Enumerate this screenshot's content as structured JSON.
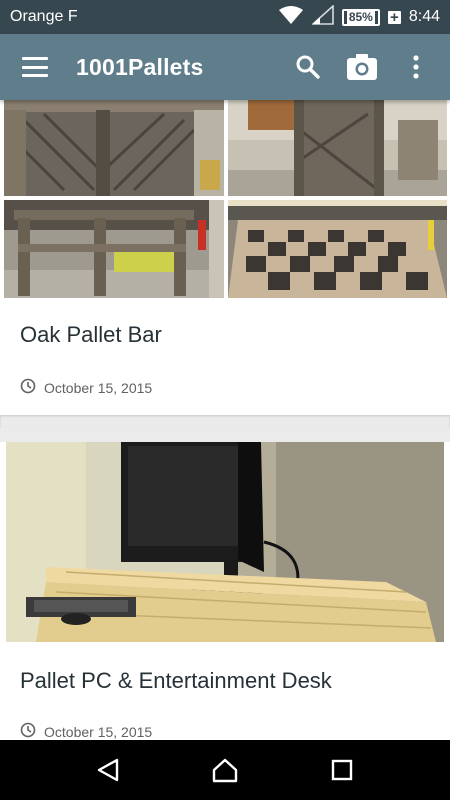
{
  "status_bar": {
    "carrier": "Orange F",
    "battery": "85%",
    "charging_symbol": "+",
    "time": "8:44"
  },
  "app_bar": {
    "title": "1001Pallets",
    "actions": [
      "menu-icon",
      "search-icon",
      "camera-icon",
      "more-vert-icon"
    ]
  },
  "posts": [
    {
      "title": "Oak Pallet Bar",
      "date": "October 15, 2015"
    },
    {
      "title": "Pallet PC & Entertainment Desk",
      "date": "October 15, 2015"
    }
  ],
  "nav_bar": {
    "buttons": [
      "back-icon",
      "home-icon",
      "recents-icon"
    ]
  },
  "colors": {
    "status_bar": "#37474f",
    "app_bar": "#607d8b",
    "title_text": "#263238",
    "meta_text": "#616161"
  }
}
